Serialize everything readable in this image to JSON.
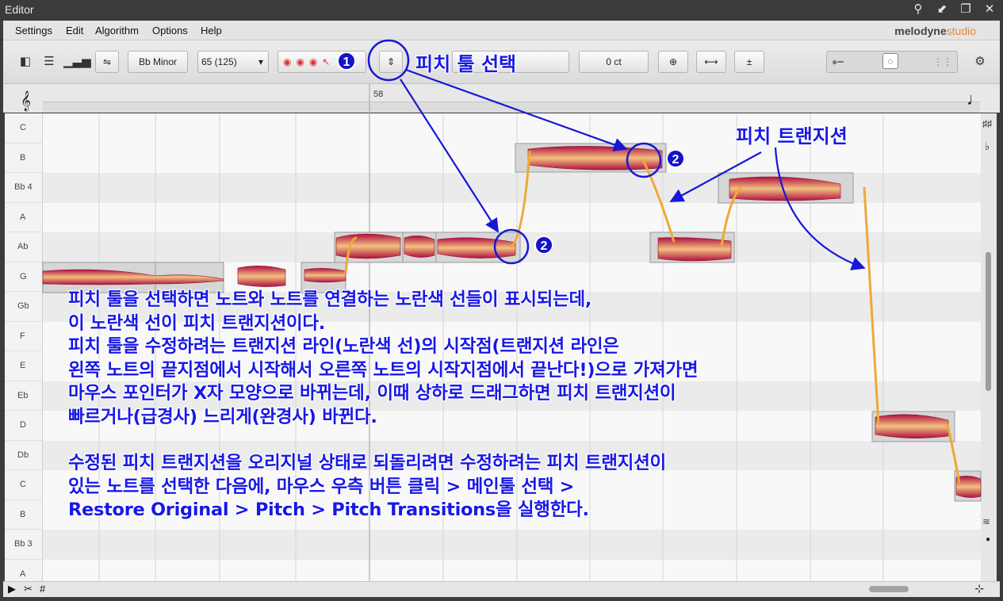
{
  "window": {
    "title": "Editor"
  },
  "menu": {
    "items": [
      "Settings",
      "Edit",
      "Algorithm",
      "Options",
      "Help"
    ],
    "brand": "melodyne",
    "brand_edition": "studio"
  },
  "toolbar": {
    "scale": "Bb Minor",
    "tempo": "65 (125)",
    "cent_value": "0 ct"
  },
  "ruler": {
    "bar_number": "58"
  },
  "pitch_lanes": [
    "C",
    "B",
    "Bb 4",
    "A",
    "Ab",
    "G",
    "Gb",
    "F",
    "E",
    "Eb",
    "D",
    "Db",
    "C",
    "B",
    "Bb 3",
    "A"
  ],
  "annotations": {
    "tool_callout": "피치 툴 선택",
    "transition_callout": "피치 트랜지션",
    "badge_one": "1",
    "badge_two": "2",
    "body_lines": [
      "피치 툴을 선택하면 노트와 노트를 연결하는 노란색 선들이 표시되는데,",
      "이 노란색 선이 피치 트랜지션이다.",
      "피치 툴을 수정하려는 트랜지션 라인(노란색 선)의 시작점(트랜지션 라인은",
      "왼쪽 노트의 끝지점에서 시작해서 오른쪽 노트의 시작지점에서 끝난다!)으로 가져가면",
      "마우스 포인터가 X자 모양으로 바뀌는데, 이때 상하로 드래그하면 피치 트랜지션이",
      "빠르거나(급경사) 느리게(완경사) 바뀐다."
    ],
    "restore_lines": [
      "수정된 피치 트랜지션을 오리지널 상태로 되돌리려면 수정하려는 피치 트랜지션이",
      "있는 노트를 선택한 다음에, 마우스 우측 버튼 클릭 > 메인툴 선택 >",
      "Restore Original > Pitch > Pitch Transitions을 실행한다."
    ]
  }
}
